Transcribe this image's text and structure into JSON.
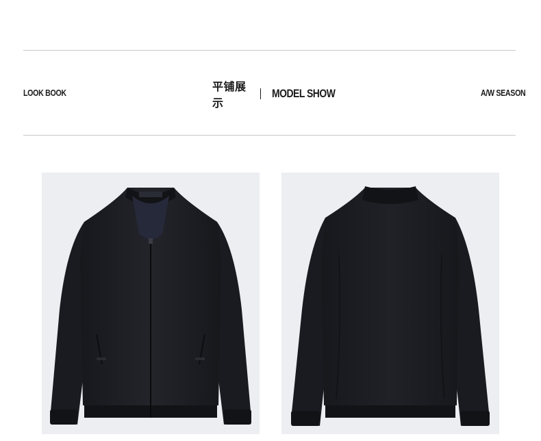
{
  "header": {
    "left_label": "LOOK BOOK",
    "center_cn": "平铺展示",
    "center_en": "MODEL SHOW",
    "right_label": "A/W SEASON"
  },
  "images": {
    "front": {
      "kind": "jacket-front",
      "label_text": ""
    },
    "back": {
      "kind": "jacket-back"
    }
  },
  "colors": {
    "text": "#1a1a1a",
    "rule": "#c9c9c9",
    "photo_bg": "#eceef1",
    "jacket": "#1c1d22"
  }
}
